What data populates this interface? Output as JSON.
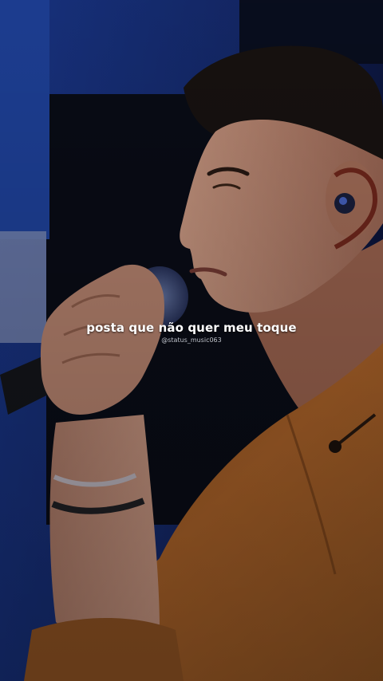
{
  "video": {
    "lyric_caption": "posta que não quer meu toque",
    "watermark_handle": "@status_music063"
  },
  "colors": {
    "backdrop_blue": "#1f3f9c",
    "shirt_orange": "#b86a2c",
    "skin": "#c98e78"
  }
}
